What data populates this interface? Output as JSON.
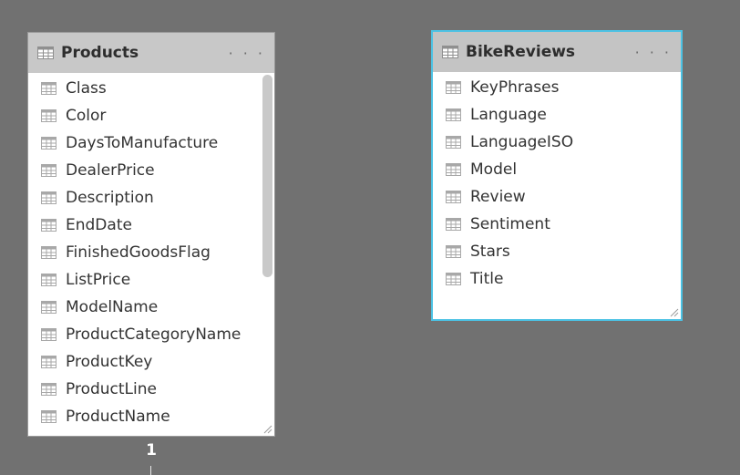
{
  "colors": {
    "canvas_bg": "#717171",
    "header_bg": "#c8c8c8",
    "selected_border": "#4cc2e4",
    "table_icon": "#aeaeae"
  },
  "tables": [
    {
      "title": "Products",
      "menu": "· · ·",
      "icon": "table-icon",
      "selected": false,
      "fields": [
        "Class",
        "Color",
        "DaysToManufacture",
        "DealerPrice",
        "Description",
        "EndDate",
        "FinishedGoodsFlag",
        "ListPrice",
        "ModelName",
        "ProductCategoryName",
        "ProductKey",
        "ProductLine",
        "ProductName"
      ]
    },
    {
      "title": "BikeReviews",
      "menu": "· · ·",
      "icon": "table-icon",
      "selected": true,
      "fields": [
        "KeyPhrases",
        "Language",
        "LanguageISO",
        "Model",
        "Review",
        "Sentiment",
        "Stars",
        "Title"
      ]
    }
  ],
  "relationship": {
    "cardinality": "1"
  }
}
